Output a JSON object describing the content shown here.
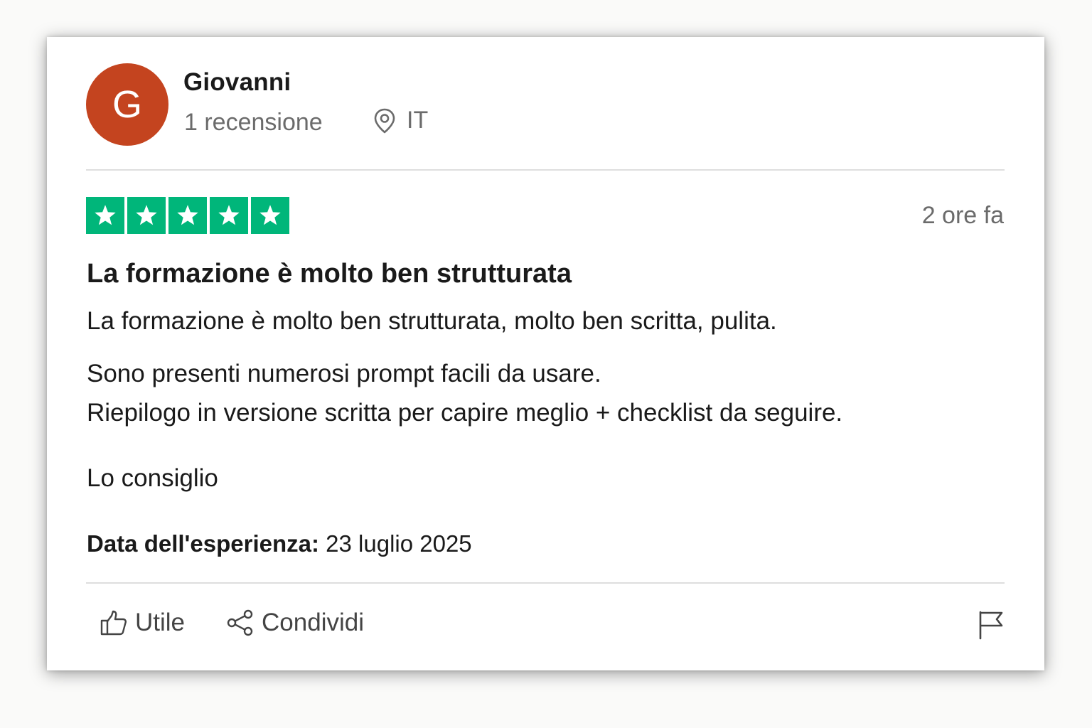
{
  "reviewer": {
    "initial": "G",
    "name": "Giovanni",
    "review_count": "1 recensione",
    "country": "IT",
    "avatar_color": "#c4441f",
    "location_icon": "location-pin-icon"
  },
  "review": {
    "rating": 5,
    "max_rating": 5,
    "star_color": "#00b67a",
    "time_ago": "2 ore fa",
    "title": "La formazione è molto ben strutturata",
    "paragraphs": [
      "La formazione è molto ben strutturata, molto ben scritta, pulita.",
      "Sono presenti numerosi prompt facili da usare.",
      "Riepilogo in versione scritta per capire meglio + checklist da seguire.",
      "Lo consiglio"
    ],
    "experience_label": "Data dell'esperienza:",
    "experience_date": "23 luglio 2025"
  },
  "actions": {
    "useful_label": "Utile",
    "useful_icon": "thumbs-up-icon",
    "share_label": "Condividi",
    "share_icon": "share-icon",
    "report_icon": "flag-icon"
  }
}
